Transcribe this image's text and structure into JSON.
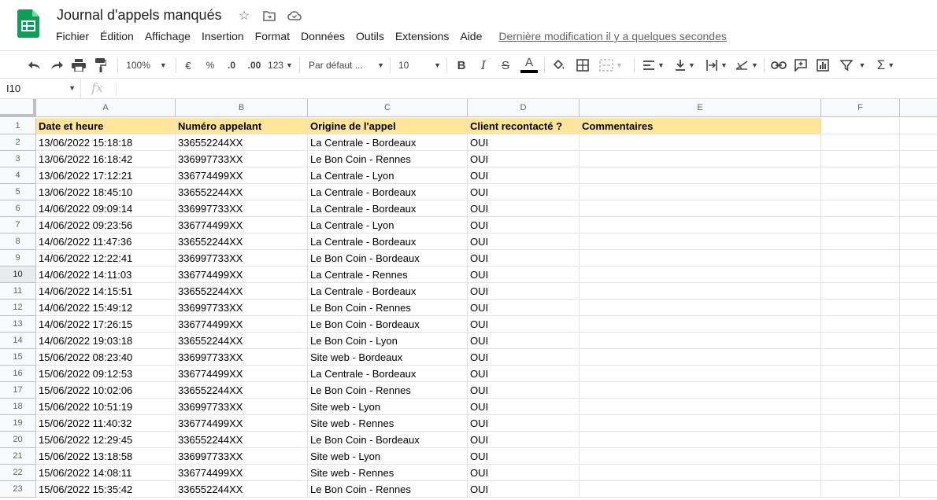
{
  "app": {
    "doc_title": "Journal d'appels manqués",
    "menu": [
      "Fichier",
      "Édition",
      "Affichage",
      "Insertion",
      "Format",
      "Données",
      "Outils",
      "Extensions",
      "Aide"
    ],
    "last_modified": "Dernière modification il y a quelques secondes"
  },
  "toolbar": {
    "zoom": "100%",
    "currency": "€",
    "percent": "%",
    "decrease_decimals": ".0",
    "increase_decimals": ".00",
    "more_formats": "123",
    "font": "Par défaut ...",
    "font_size": "10",
    "text_color": "#000000"
  },
  "formula_bar": {
    "name_box": "I10",
    "fx": "fx",
    "content": ""
  },
  "sheet": {
    "columns": [
      "A",
      "B",
      "C",
      "D",
      "E",
      "F"
    ],
    "header_fill": "#ffe599",
    "selected_row": 10,
    "header_row": {
      "num": "1",
      "cells": [
        "Date et heure",
        "Numéro appelant",
        "Origine de l'appel",
        "Client recontacté ?",
        "Commentaires"
      ]
    },
    "rows": [
      {
        "num": "2",
        "cells": [
          "13/06/2022 15:18:18",
          "336552244XX",
          "La Centrale - Bordeaux",
          "OUI",
          ""
        ]
      },
      {
        "num": "3",
        "cells": [
          "13/06/2022 16:18:42",
          "336997733XX",
          "Le Bon Coin - Rennes",
          "OUI",
          ""
        ]
      },
      {
        "num": "4",
        "cells": [
          "13/06/2022 17:12:21",
          "336774499XX",
          "La Centrale - Lyon",
          "OUI",
          ""
        ]
      },
      {
        "num": "5",
        "cells": [
          "13/06/2022 18:45:10",
          "336552244XX",
          "La Centrale - Bordeaux",
          "OUI",
          ""
        ]
      },
      {
        "num": "6",
        "cells": [
          "14/06/2022 09:09:14",
          "336997733XX",
          "La Centrale - Bordeaux",
          "OUI",
          ""
        ]
      },
      {
        "num": "7",
        "cells": [
          "14/06/2022 09:23:56",
          "336774499XX",
          "La Centrale - Lyon",
          "OUI",
          ""
        ]
      },
      {
        "num": "8",
        "cells": [
          "14/06/2022 11:47:36",
          "336552244XX",
          "La Centrale - Bordeaux",
          "OUI",
          ""
        ]
      },
      {
        "num": "9",
        "cells": [
          "14/06/2022 12:22:41",
          "336997733XX",
          "Le Bon Coin - Bordeaux",
          "OUI",
          ""
        ]
      },
      {
        "num": "10",
        "cells": [
          "14/06/2022 14:11:03",
          "336774499XX",
          "La Centrale - Rennes",
          "OUI",
          ""
        ]
      },
      {
        "num": "11",
        "cells": [
          "14/06/2022 14:15:51",
          "336552244XX",
          "La Centrale - Bordeaux",
          "OUI",
          ""
        ]
      },
      {
        "num": "12",
        "cells": [
          "14/06/2022 15:49:12",
          "336997733XX",
          "Le Bon Coin - Rennes",
          "OUI",
          ""
        ]
      },
      {
        "num": "13",
        "cells": [
          "14/06/2022 17:26:15",
          "336774499XX",
          "Le Bon Coin - Bordeaux",
          "OUI",
          ""
        ]
      },
      {
        "num": "14",
        "cells": [
          "14/06/2022 19:03:18",
          "336552244XX",
          "Le Bon Coin - Lyon",
          "OUI",
          ""
        ]
      },
      {
        "num": "15",
        "cells": [
          "15/06/2022 08:23:40",
          "336997733XX",
          "Site web - Bordeaux",
          "OUI",
          ""
        ]
      },
      {
        "num": "16",
        "cells": [
          "15/06/2022 09:12:53",
          "336774499XX",
          "La Centrale - Bordeaux",
          "OUI",
          ""
        ]
      },
      {
        "num": "17",
        "cells": [
          "15/06/2022 10:02:06",
          "336552244XX",
          "Le Bon Coin - Rennes",
          "OUI",
          ""
        ]
      },
      {
        "num": "18",
        "cells": [
          "15/06/2022 10:51:19",
          "336997733XX",
          "Site web - Lyon",
          "OUI",
          ""
        ]
      },
      {
        "num": "19",
        "cells": [
          "15/06/2022 11:40:32",
          "336774499XX",
          "Site web - Rennes",
          "OUI",
          ""
        ]
      },
      {
        "num": "20",
        "cells": [
          "15/06/2022 12:29:45",
          "336552244XX",
          "Le Bon Coin - Bordeaux",
          "OUI",
          ""
        ]
      },
      {
        "num": "21",
        "cells": [
          "15/06/2022 13:18:58",
          "336997733XX",
          "Site web - Lyon",
          "OUI",
          ""
        ]
      },
      {
        "num": "22",
        "cells": [
          "15/06/2022 14:08:11",
          "336774499XX",
          "Site web - Rennes",
          "OUI",
          ""
        ]
      },
      {
        "num": "23",
        "cells": [
          "15/06/2022 15:35:42",
          "336552244XX",
          "Le Bon Coin - Rennes",
          "OUI",
          ""
        ]
      }
    ]
  }
}
